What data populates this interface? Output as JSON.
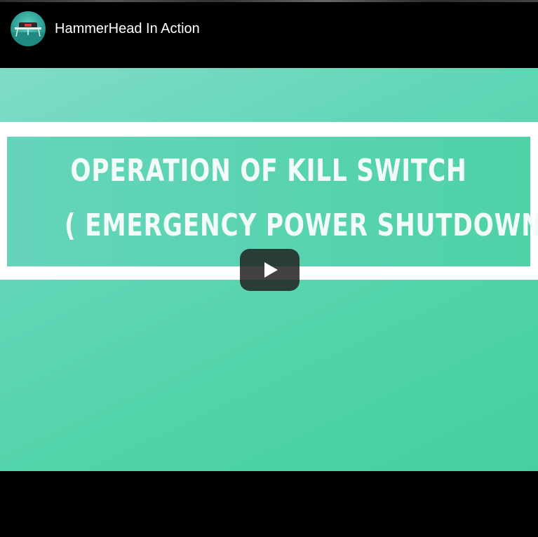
{
  "header": {
    "title": "HammerHead In Action",
    "avatar_icon": "channel-logo-icon"
  },
  "video": {
    "title_card": {
      "line1": "OPERATION OF KILL SWITCH",
      "line2": "( EMERGENCY POWER SHUTDOWN )"
    },
    "play_icon": "play-icon"
  },
  "colors": {
    "background": "#000000",
    "card_green": "#5ad3b1",
    "band_white": "#ffffff",
    "play_button": "#212121"
  }
}
